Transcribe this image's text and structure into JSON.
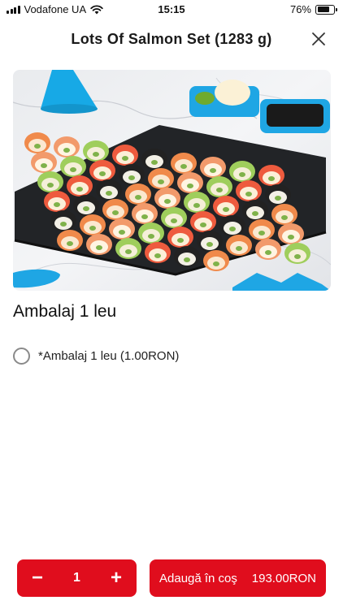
{
  "status_bar": {
    "carrier": "Vodafone UA",
    "time": "15:15",
    "battery_percent": "76%",
    "battery_level": 0.76
  },
  "header": {
    "title": "Lots Of Salmon Set (1283 g)",
    "close_icon": "close-icon"
  },
  "product": {
    "image_icon": "sushi-set-photo"
  },
  "packaging": {
    "section_title": "Ambalaj 1 leu",
    "options": [
      {
        "label": "*Ambalaj 1 leu (1.00RON)",
        "selected": false
      }
    ]
  },
  "footer": {
    "quantity": "1",
    "minus_label": "−",
    "plus_label": "+",
    "add_to_cart_label": "Adaugă în coş",
    "price": "193.00RON",
    "accent_color": "#e00d1d"
  }
}
